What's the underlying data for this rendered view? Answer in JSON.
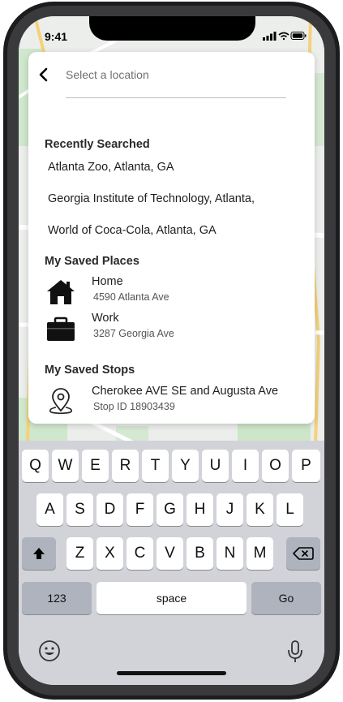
{
  "status": {
    "time": "9:41"
  },
  "search": {
    "placeholder": "Select a location"
  },
  "recent": {
    "title": "Recently Searched",
    "items": [
      "Atlanta Zoo, Atlanta, GA",
      "Georgia Institute of Technology, Atlanta,",
      "World of Coca-Cola, Atlanta, GA"
    ]
  },
  "saved_places": {
    "title": "My Saved Places",
    "items": [
      {
        "name": "Home",
        "address": "4590 Atlanta Ave",
        "icon": "house-icon"
      },
      {
        "name": "Work",
        "address": "3287 Georgia Ave",
        "icon": "briefcase-icon"
      }
    ]
  },
  "saved_stops": {
    "title": "My Saved Stops",
    "items": [
      {
        "name": "Cherokee AVE SE and Augusta Ave",
        "stop_id": "Stop ID 18903439",
        "icon": "location-pin-icon"
      }
    ]
  },
  "keyboard": {
    "row1": [
      "Q",
      "W",
      "E",
      "R",
      "T",
      "Y",
      "U",
      "I",
      "O",
      "P"
    ],
    "row2": [
      "A",
      "S",
      "D",
      "F",
      "G",
      "H",
      "J",
      "K",
      "L"
    ],
    "row3": [
      "Z",
      "X",
      "C",
      "V",
      "B",
      "N",
      "M"
    ],
    "numbers_label": "123",
    "space_label": "space",
    "go_label": "Go"
  },
  "colors": {
    "card": "#ffffff",
    "keyboard": "#d1d3d9",
    "dark_key": "#aeb3bd"
  }
}
